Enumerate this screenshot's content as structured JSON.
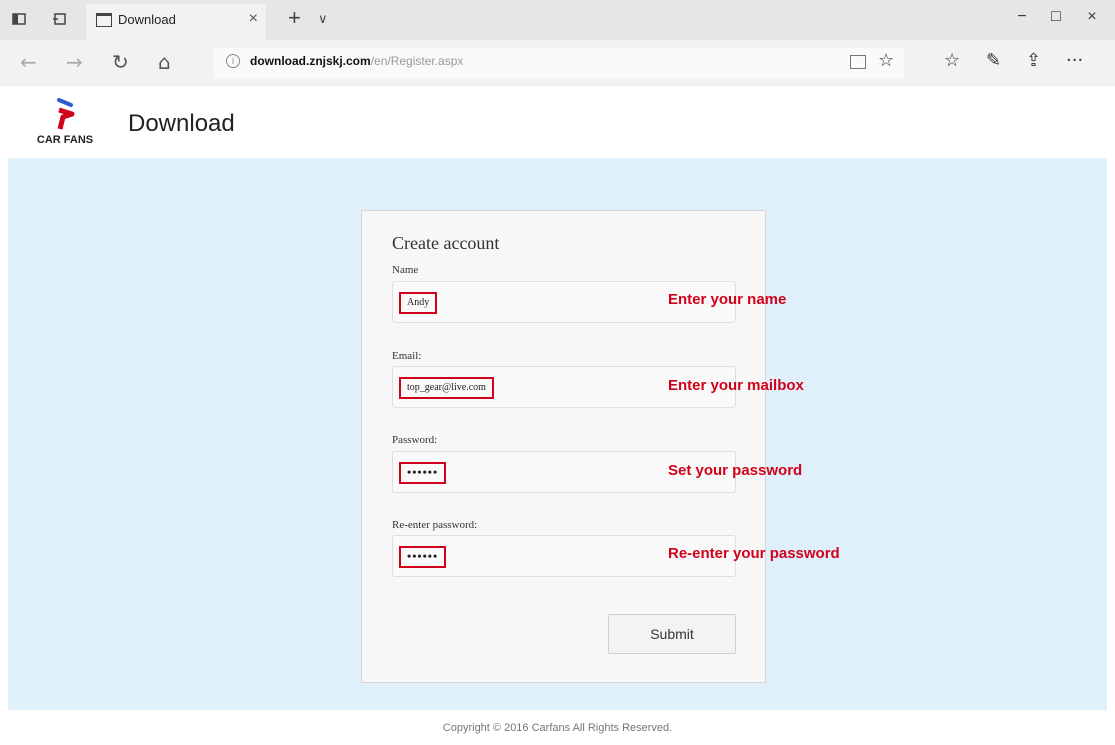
{
  "browser": {
    "tab_title": "Download",
    "tab_close": "×",
    "new_tab": "+",
    "tab_menu": "∨",
    "window": {
      "minimize": "−",
      "maximize": "□",
      "close": "×"
    },
    "nav": {
      "back": "←",
      "forward": "→",
      "refresh": "↻",
      "home": "⌂"
    },
    "url_info": "i",
    "url_host": "download.znjskj.com",
    "url_path": "/en/Register.aspx",
    "star": "☆",
    "tools": {
      "favorites": "☆",
      "notes": "✎",
      "share": "⇪",
      "more": "···"
    }
  },
  "site": {
    "logo_text": "CAR FANS",
    "title": "Download",
    "brand_colors": {
      "blue": "#2f5bd0",
      "red": "#d0021b"
    }
  },
  "form": {
    "title": "Create account",
    "name_label": "Name",
    "name_value": "Andy",
    "email_label": "Email:",
    "email_value": "top_gear@live.com",
    "password_label": "Password:",
    "password_value": "••••••",
    "reenter_label": "Re-enter password:",
    "reenter_value": "••••••",
    "submit_label": "Submit"
  },
  "annotations": {
    "name": "Enter your name",
    "email": "Enter your mailbox",
    "password": "Set your password",
    "reenter": "Re-enter your password",
    "color": "#d0021b"
  },
  "footer": {
    "copyright": "Copyright © 2016 Carfans All Rights Reserved."
  }
}
